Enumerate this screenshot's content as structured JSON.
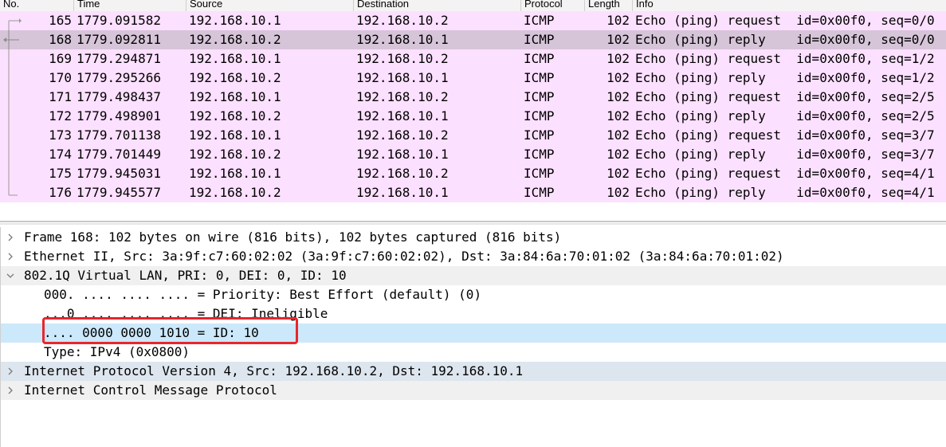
{
  "columns": [
    "No.",
    "Time",
    "Source",
    "Destination",
    "Protocol",
    "Length",
    "Info"
  ],
  "packets": [
    {
      "no": "165",
      "time": "1779.091582",
      "src": "192.168.10.1",
      "dst": "192.168.10.2",
      "proto": "ICMP",
      "len": "102",
      "info": "Echo (ping) request  id=0x00f0, seq=0/0"
    },
    {
      "no": "168",
      "time": "1779.092811",
      "src": "192.168.10.2",
      "dst": "192.168.10.1",
      "proto": "ICMP",
      "len": "102",
      "info": "Echo (ping) reply    id=0x00f0, seq=0/0"
    },
    {
      "no": "169",
      "time": "1779.294871",
      "src": "192.168.10.1",
      "dst": "192.168.10.2",
      "proto": "ICMP",
      "len": "102",
      "info": "Echo (ping) request  id=0x00f0, seq=1/2"
    },
    {
      "no": "170",
      "time": "1779.295266",
      "src": "192.168.10.2",
      "dst": "192.168.10.1",
      "proto": "ICMP",
      "len": "102",
      "info": "Echo (ping) reply    id=0x00f0, seq=1/2"
    },
    {
      "no": "171",
      "time": "1779.498437",
      "src": "192.168.10.1",
      "dst": "192.168.10.2",
      "proto": "ICMP",
      "len": "102",
      "info": "Echo (ping) request  id=0x00f0, seq=2/5"
    },
    {
      "no": "172",
      "time": "1779.498901",
      "src": "192.168.10.2",
      "dst": "192.168.10.1",
      "proto": "ICMP",
      "len": "102",
      "info": "Echo (ping) reply    id=0x00f0, seq=2/5"
    },
    {
      "no": "173",
      "time": "1779.701138",
      "src": "192.168.10.1",
      "dst": "192.168.10.2",
      "proto": "ICMP",
      "len": "102",
      "info": "Echo (ping) request  id=0x00f0, seq=3/7"
    },
    {
      "no": "174",
      "time": "1779.701449",
      "src": "192.168.10.2",
      "dst": "192.168.10.1",
      "proto": "ICMP",
      "len": "102",
      "info": "Echo (ping) reply    id=0x00f0, seq=3/7"
    },
    {
      "no": "175",
      "time": "1779.945031",
      "src": "192.168.10.1",
      "dst": "192.168.10.2",
      "proto": "ICMP",
      "len": "102",
      "info": "Echo (ping) request  id=0x00f0, seq=4/1"
    },
    {
      "no": "176",
      "time": "1779.945577",
      "src": "192.168.10.2",
      "dst": "192.168.10.1",
      "proto": "ICMP",
      "len": "102",
      "info": "Echo (ping) reply    id=0x00f0, seq=4/1"
    }
  ],
  "selected_packet_no": "168",
  "details": [
    {
      "text": "Frame 168: 102 bytes on wire (816 bits), 102 bytes captured (816 bits)",
      "indent": 0,
      "chevron": "right",
      "bg": "#ffffff"
    },
    {
      "text": "Ethernet II, Src: 3a:9f:c7:60:02:02 (3a:9f:c7:60:02:02), Dst: 3a:84:6a:70:01:02 (3a:84:6a:70:01:02)",
      "indent": 0,
      "chevron": "right",
      "bg": "#ffffff"
    },
    {
      "text": "802.1Q Virtual LAN, PRI: 0, DEI: 0, ID: 10",
      "indent": 0,
      "chevron": "down",
      "bg": "#f0f0f0"
    },
    {
      "text": "000. .... .... .... = Priority: Best Effort (default) (0)",
      "indent": 1,
      "chevron": "",
      "bg": "#ffffff"
    },
    {
      "text": "...0 .... .... .... = DEI: Ineligible",
      "indent": 1,
      "chevron": "",
      "bg": "#ffffff"
    },
    {
      "text": ".... 0000 0000 1010 = ID: 10",
      "indent": 1,
      "chevron": "",
      "bg": "#cce8fb"
    },
    {
      "text": "Type: IPv4 (0x0800)",
      "indent": 1,
      "chevron": "",
      "bg": "#ffffff"
    },
    {
      "text": "Internet Protocol Version 4, Src: 192.168.10.2, Dst: 192.168.10.1",
      "indent": 0,
      "chevron": "right",
      "bg": "#dde6ee"
    },
    {
      "text": "Internet Control Message Protocol",
      "indent": 0,
      "chevron": "right",
      "bg": "#f0f0f0"
    }
  ],
  "colors": {
    "icmp_row": "#fce0ff",
    "selected_row": "#d6c4d8",
    "highlight_box": "#e8262b",
    "selected_field": "#cce8fb"
  }
}
